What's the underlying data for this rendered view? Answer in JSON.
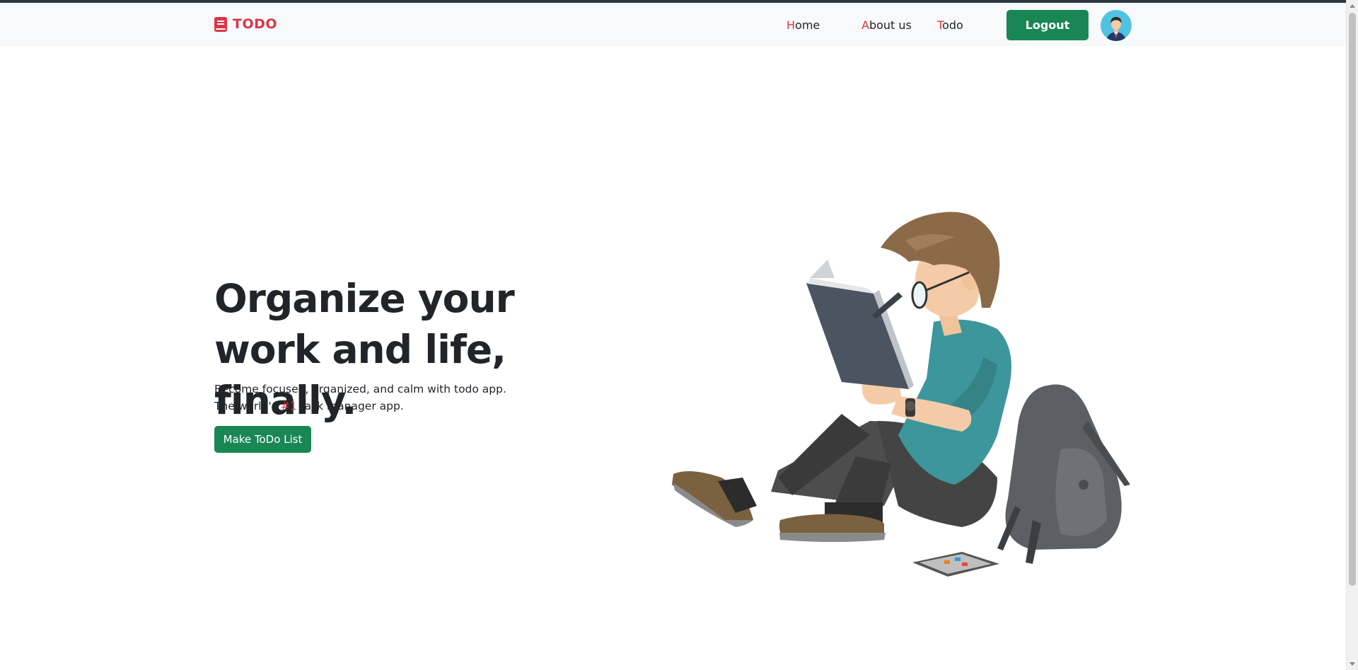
{
  "brand": {
    "name": "TODO",
    "icon": "book-icon"
  },
  "nav": {
    "links": [
      {
        "first": "H",
        "rest": "ome"
      },
      {
        "first": "A",
        "rest": "bout us"
      },
      {
        "first": "T",
        "rest": "odo"
      }
    ],
    "logout_label": "Logout",
    "avatar_icon": "user-avatar-icon"
  },
  "hero": {
    "title_line1": "Organize your",
    "title_line2": "work and life, finally.",
    "subtitle_line1": "Become focused, organized, and calm with todo app.",
    "subtitle_line2_pre": "The world's ",
    "subtitle_line2_accent": "#1",
    "subtitle_line2_post": " task manager app.",
    "cta_label": "Make ToDo List"
  },
  "colors": {
    "accent_red": "#dc3545",
    "button_green": "#198754",
    "navbar_bg": "#f8f9fa",
    "text_dark": "#212529"
  }
}
